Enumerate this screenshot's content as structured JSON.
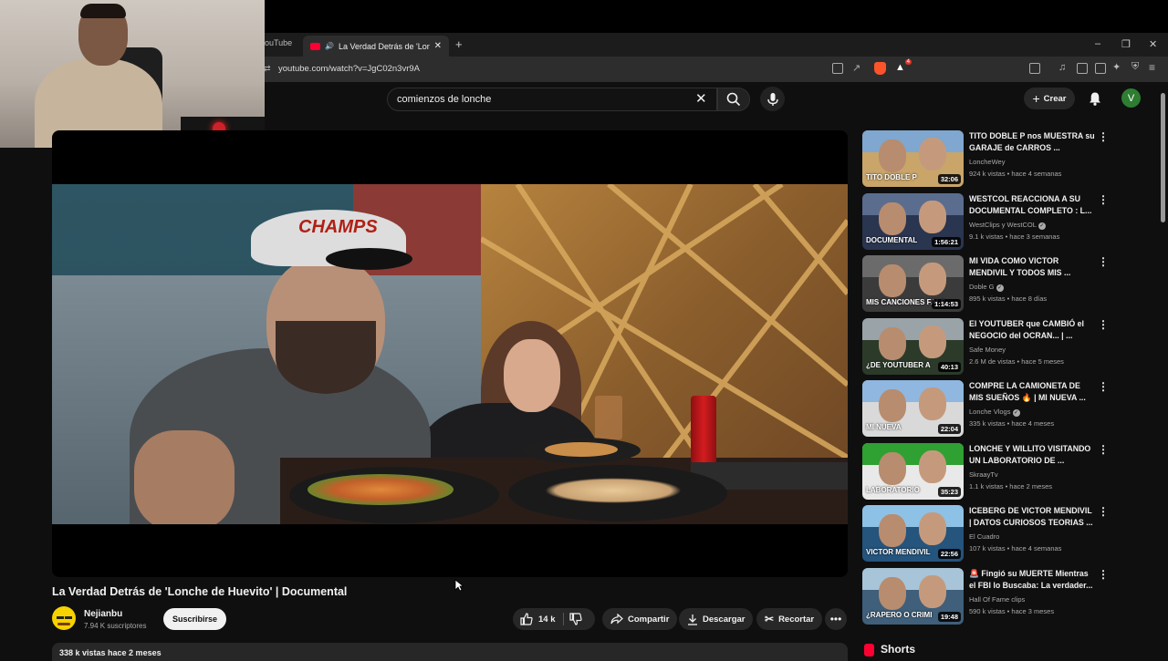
{
  "browser": {
    "prev_tab_label": "ouTube",
    "active_tab_label": "La Verdad Detrás de 'Lonche",
    "url": "youtube.com/watch?v=JgC02n3vr9A",
    "brave_badge": "4",
    "window_controls": [
      "–",
      "❐",
      "✕"
    ]
  },
  "header": {
    "search_value": "comienzos de lonche",
    "create_label": "Crear",
    "avatar_letter": "V"
  },
  "video": {
    "cap_text": "CHAMPS",
    "title": "La Verdad Detrás de 'Lonche de Huevito' | Documental",
    "channel_name": "Nejianbu",
    "channel_subs": "7.94 K suscriptores",
    "subscribe_label": "Suscribirse",
    "likes": "14 k",
    "share_label": "Compartir",
    "download_label": "Descargar",
    "clip_label": "Recortar",
    "description_meta": "338 k vistas  hace 2 meses"
  },
  "sidebar": {
    "recommendations": [
      {
        "title": "TITO DOBLE P nos MUESTRA su GARAJE de CARROS ...",
        "channel": "LoncheWey",
        "verified": false,
        "meta": "924 k vistas • hace 4 semanas",
        "duration": "32:06",
        "thumb_bg": "#c9a56a",
        "thumb_top": "#7fa7cf",
        "thumb_text": "TITO DOBLE P"
      },
      {
        "title": "WESTCOL REACCIONA A SU DOCUMENTAL COMPLETO : L...",
        "channel": "WestClips",
        "channel_suffix": "y WestCOL",
        "verified": true,
        "meta": "9.1 k vistas • hace 3 semanas",
        "duration": "1:56:21",
        "thumb_bg": "#2a3550",
        "thumb_top": "#5a6d8f",
        "thumb_text": "DOCUMENTAL"
      },
      {
        "title": "MI VIDA COMO VICTOR MENDIVIL Y TODOS MIS ...",
        "channel": "Doble G",
        "verified": true,
        "meta": "895 k vistas • hace 8 días",
        "duration": "1:14:53",
        "thumb_bg": "#3b3b3b",
        "thumb_top": "#6b6b6b",
        "thumb_text": "MIS CANCIONES FALS"
      },
      {
        "title": "El YOUTUBER que CAMBIÓ el NEGOCIO del OCRAN... | ...",
        "channel": "Safe Money",
        "verified": false,
        "meta": "2.6 M de vistas • hace 5 meses",
        "duration": "40:13",
        "thumb_bg": "#2c3a2a",
        "thumb_top": "#9aa3a8",
        "thumb_text": "¿DE YOUTUBER A"
      },
      {
        "title": "COMPRE LA CAMIONETA DE MIS SUEÑOS 🔥 | MI NUEVA ...",
        "channel": "Lonche Vlogs",
        "verified": true,
        "meta": "335 k vistas • hace 4 meses",
        "duration": "22:04",
        "thumb_bg": "#d9d9d9",
        "thumb_top": "#8fb7e0",
        "thumb_text": "MI NUEVA"
      },
      {
        "title": "LONCHE Y WILLITO VISITANDO UN LABORATORIO DE ...",
        "channel": "SkraayTv",
        "verified": false,
        "meta": "1.1 k vistas • hace 2 meses",
        "duration": "35:23",
        "thumb_bg": "#e9e9e9",
        "thumb_top": "#2fa032",
        "thumb_text": "LABORATORIO"
      },
      {
        "title": "ICEBERG DE VICTOR MENDIVIL | DATOS CURIOSOS TEORIAS ...",
        "channel": "El Cuadro",
        "verified": false,
        "meta": "107 k vistas • hace 4 semanas",
        "duration": "22:56",
        "thumb_bg": "#25547d",
        "thumb_top": "#8ec1e6",
        "thumb_text": "VICTOR MENDIVIL"
      },
      {
        "title": "🚨 Fingió su MUERTE Mientras el FBI lo Buscaba: La verdader...",
        "channel": "Hall Of Fame clips",
        "verified": false,
        "meta": "590 k vistas • hace 3 meses",
        "duration": "19:48",
        "thumb_bg": "#3f5f7a",
        "thumb_top": "#a8c4d8",
        "thumb_text": "¿RAPERO O CRIMI"
      }
    ],
    "shorts_label": "Shorts"
  }
}
